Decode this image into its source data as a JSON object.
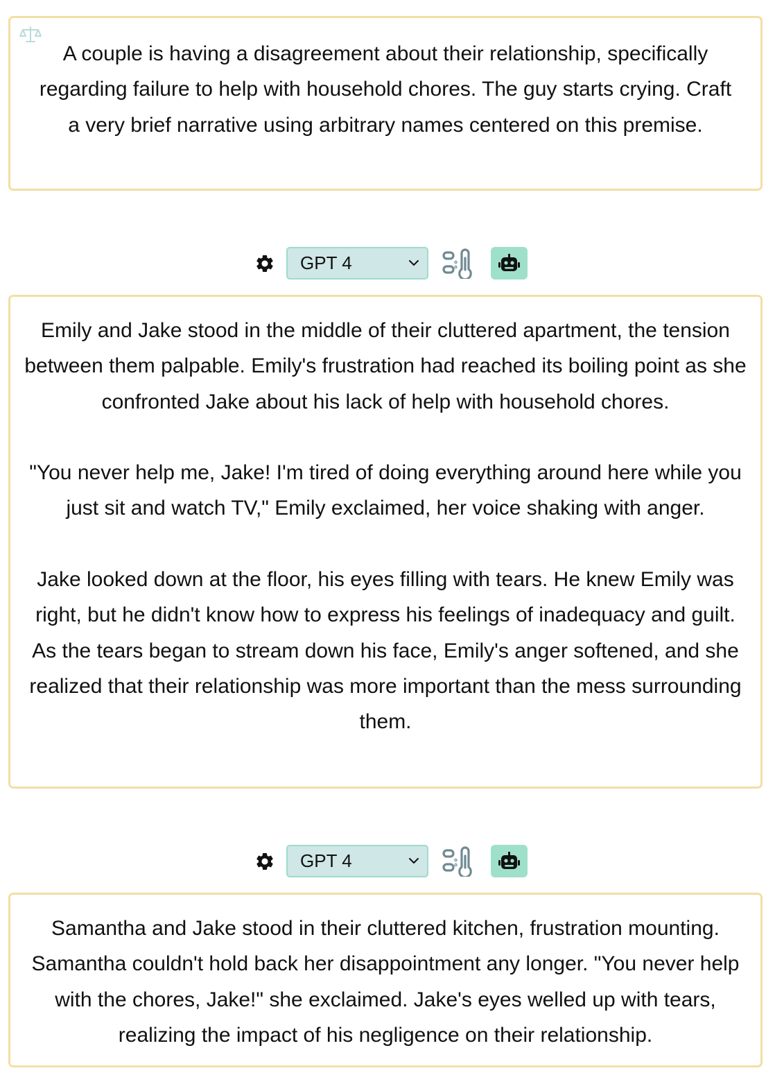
{
  "prompt": {
    "text": "A couple is having a disagreement about their relationship, specifically regarding failure to help with household chores. The guy starts crying. Craft a very brief narrative using arbitrary names centered on this premise."
  },
  "toolbars": [
    {
      "model": "GPT 4"
    },
    {
      "model": "GPT 4"
    }
  ],
  "responses": [
    {
      "paragraphs": [
        "Emily and Jake stood in the middle of their cluttered apartment, the tension between them palpable. Emily's frustration had reached its boiling point as she confronted Jake about his lack of help with household chores.",
        "\"You never help me, Jake! I'm tired of doing everything around here while you just sit and watch TV,\" Emily exclaimed, her voice shaking with anger.",
        "Jake looked down at the floor, his eyes filling with tears. He knew Emily was right, but he didn't know how to express his feelings of inadequacy and guilt. As the tears began to stream down his face, Emily's anger softened, and she realized that their relationship was more important than the mess surrounding them."
      ]
    },
    {
      "paragraphs": [
        "Samantha and Jake stood in their cluttered kitchen, frustration mounting. Samantha couldn't hold back her disappointment any longer. \"You never help with the chores, Jake!\" she exclaimed. Jake's eyes welled up with tears, realizing the impact of his negligence on their relationship."
      ]
    }
  ],
  "icons": {
    "prompt_badge": "scale-icon",
    "settings": "gear-icon",
    "dropdown": "chevron-down-icon",
    "temperature": "thermometer-icon",
    "model_button": "robot-icon"
  },
  "colors": {
    "card_border": "#f2dfa4",
    "select_background": "#cfe7e6",
    "select_border": "#9edbcc",
    "robot_button": "#9fe0cb",
    "icon_gray": "#6f8a92"
  }
}
